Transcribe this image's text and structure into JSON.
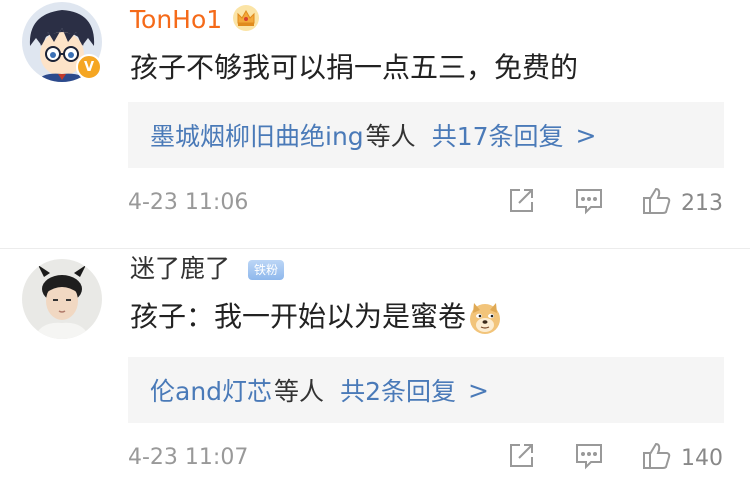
{
  "comments": [
    {
      "username": "TonHo1",
      "text": "孩子不够我可以捐一点五三，免费的",
      "replies": {
        "who": "墨城烟柳旧曲绝ing",
        "suffix": "等人",
        "count": "共17条回复",
        "arrow": ">"
      },
      "timestamp": "4-23 11:06",
      "likes": "213",
      "verified": "V",
      "name_color": "#f56a19"
    },
    {
      "username": "迷了鹿了",
      "badge": "铁粉",
      "text": "孩子：我一开始以为是蜜卷",
      "replies": {
        "who": "伦and灯芯",
        "suffix": "等人",
        "count": "共2条回复",
        "arrow": ">"
      },
      "timestamp": "4-23 11:07",
      "likes": "140"
    }
  ],
  "icons": [
    "crown-icon",
    "share-icon",
    "comment-icon",
    "like-icon",
    "doge-emoji-icon"
  ],
  "colors": {
    "link": "#4a7ab8",
    "meta": "#999999",
    "reply_bg": "#f5f5f5",
    "fan_badge": "#8fb8ec",
    "vip": "#f5a623"
  }
}
